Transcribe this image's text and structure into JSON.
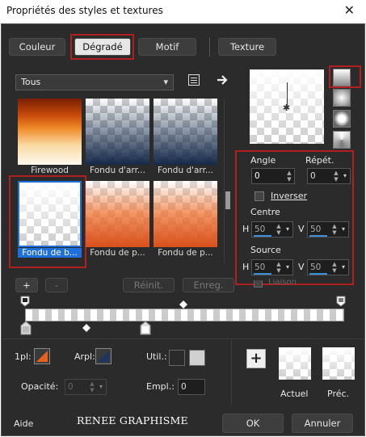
{
  "window": {
    "title": "Propriétés des styles et textures",
    "close_glyph": "✕"
  },
  "tabs": [
    {
      "label": "Couleur"
    },
    {
      "label": "Dégradé",
      "active": true
    },
    {
      "label": "Motif"
    },
    {
      "label": "Texture"
    }
  ],
  "category": {
    "value": "Tous",
    "arrow": "▾"
  },
  "presets": [
    {
      "label": "Firewood"
    },
    {
      "label": "Fondu d'arr..."
    },
    {
      "label": "Fondu d'arr..."
    },
    {
      "label": "Fondu de b...",
      "selected": true
    },
    {
      "label": "Fondu de p..."
    },
    {
      "label": "Fondu de p..."
    }
  ],
  "angle": {
    "label": "Angle",
    "value": "0"
  },
  "repeat": {
    "label": "Répét.",
    "value": "0"
  },
  "invert": {
    "label": "Inverser",
    "checked": false
  },
  "center": {
    "label": "Centre",
    "h_label": "H",
    "h_value": "50",
    "v_label": "V",
    "v_value": "50"
  },
  "source": {
    "label": "Source",
    "h_label": "H",
    "h_value": "50",
    "v_label": "V",
    "v_value": "50"
  },
  "link": {
    "label": "Liaison"
  },
  "gradient_controls": {
    "add": "+",
    "remove": "-",
    "reset": "Réinit.",
    "save": "Enreg."
  },
  "bottom": {
    "first_label": "1pl:",
    "arpl_label": "Arpl:",
    "util_label": "Util.:",
    "opacity_label": "Opacité:",
    "opacity_value": "0",
    "empl_label": "Empl.:",
    "empl_value": "0",
    "add_swatch": "+",
    "current_label": "Actuel",
    "previous_label": "Préc."
  },
  "footer": {
    "help": "Aide",
    "watermark": "RENEE GRAPHISME",
    "ok": "OK",
    "cancel": "Annuler"
  },
  "colors": {
    "accent_red": "#b02020",
    "selection_blue": "#1e6fd9",
    "background": "#2b2b2b"
  }
}
